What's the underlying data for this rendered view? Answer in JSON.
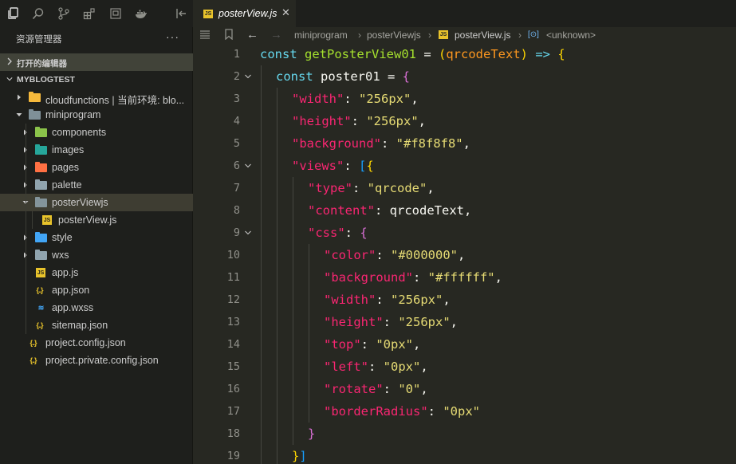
{
  "explorer": {
    "title": "资源管理器",
    "more": "···",
    "open_editors": "打开的编辑器",
    "project": "MYBLOGTEST"
  },
  "tree": [
    {
      "label": "cloudfunctions | 当前环境: blo...",
      "icon": "folder-cloud-icon",
      "color": "#f6b93b",
      "depth": 1,
      "expanded": false
    },
    {
      "label": "miniprogram",
      "icon": "folder-open-icon",
      "color": "#90a4ae",
      "depth": 1,
      "expanded": true
    },
    {
      "label": "components",
      "icon": "folder-components-icon",
      "color": "#8bc34a",
      "depth": 2,
      "expanded": false
    },
    {
      "label": "images",
      "icon": "folder-images-icon",
      "color": "#26a69a",
      "depth": 2,
      "expanded": false
    },
    {
      "label": "pages",
      "icon": "folder-pages-icon",
      "color": "#ff7043",
      "depth": 2,
      "expanded": false
    },
    {
      "label": "palette",
      "icon": "folder-icon",
      "color": "#90a4ae",
      "depth": 2,
      "expanded": false
    },
    {
      "label": "posterViewjs",
      "icon": "folder-open-icon",
      "color": "#90a4ae",
      "depth": 2,
      "expanded": true,
      "selected": true
    },
    {
      "label": "posterView.js",
      "icon": "js-file-icon",
      "color": "#e8c32b",
      "depth": 3
    },
    {
      "label": "style",
      "icon": "folder-style-icon",
      "color": "#42a5f5",
      "depth": 2,
      "expanded": false
    },
    {
      "label": "wxs",
      "icon": "folder-icon",
      "color": "#90a4ae",
      "depth": 2,
      "expanded": false
    },
    {
      "label": "app.js",
      "icon": "js-file-icon",
      "color": "#e8c32b",
      "depth": 2
    },
    {
      "label": "app.json",
      "icon": "json-file-icon",
      "color": "#e8c32b",
      "depth": 2
    },
    {
      "label": "app.wxss",
      "icon": "css-file-icon",
      "color": "#42a5f5",
      "depth": 2
    },
    {
      "label": "sitemap.json",
      "icon": "json-file-icon",
      "color": "#e8c32b",
      "depth": 2
    },
    {
      "label": "project.config.json",
      "icon": "json-file-icon",
      "color": "#e8c32b",
      "depth": 1
    },
    {
      "label": "project.private.config.json",
      "icon": "json-file-icon",
      "color": "#e8c32b",
      "depth": 1
    }
  ],
  "tab": {
    "icon_text": "JS",
    "label": "posterView.js",
    "close": "✕"
  },
  "breadcrumbs": {
    "parts": [
      "miniprogram",
      "posterViewjs",
      "posterView.js",
      "<unknown>"
    ],
    "js_icon": "JS",
    "symbol_icon": "[⊙]"
  },
  "code": {
    "line_numbers": [
      "1",
      "2",
      "3",
      "4",
      "5",
      "6",
      "7",
      "8",
      "9",
      "10",
      "11",
      "12",
      "13",
      "14",
      "15",
      "16",
      "17",
      "18",
      "19"
    ],
    "lines": [
      [
        [
          "kw",
          "const "
        ],
        [
          "fn",
          "getPosterView01"
        ],
        [
          "plain",
          " = "
        ],
        [
          "br1",
          "("
        ],
        [
          "param",
          "qrcodeText"
        ],
        [
          "br1",
          ")"
        ],
        [
          "kw",
          " => "
        ],
        [
          "br1",
          "{"
        ]
      ],
      [
        [
          "kw",
          "const "
        ],
        [
          "plain",
          "poster01 = "
        ],
        [
          "br2",
          "{"
        ]
      ],
      [
        [
          "key",
          "\"width\""
        ],
        [
          "punc",
          ": "
        ],
        [
          "str",
          "\"256px\""
        ],
        [
          "punc",
          ","
        ]
      ],
      [
        [
          "key",
          "\"height\""
        ],
        [
          "punc",
          ": "
        ],
        [
          "str",
          "\"256px\""
        ],
        [
          "punc",
          ","
        ]
      ],
      [
        [
          "key",
          "\"background\""
        ],
        [
          "punc",
          ": "
        ],
        [
          "str",
          "\"#f8f8f8\""
        ],
        [
          "punc",
          ","
        ]
      ],
      [
        [
          "key",
          "\"views\""
        ],
        [
          "punc",
          ": "
        ],
        [
          "br3",
          "["
        ],
        [
          "br1",
          "{"
        ]
      ],
      [
        [
          "key",
          "\"type\""
        ],
        [
          "punc",
          ": "
        ],
        [
          "str",
          "\"qrcode\""
        ],
        [
          "punc",
          ","
        ]
      ],
      [
        [
          "key",
          "\"content\""
        ],
        [
          "punc",
          ": "
        ],
        [
          "plain",
          "qrcodeText"
        ],
        [
          "punc",
          ","
        ]
      ],
      [
        [
          "key",
          "\"css\""
        ],
        [
          "punc",
          ": "
        ],
        [
          "br2",
          "{"
        ]
      ],
      [
        [
          "key",
          "\"color\""
        ],
        [
          "punc",
          ": "
        ],
        [
          "str",
          "\"#000000\""
        ],
        [
          "punc",
          ","
        ]
      ],
      [
        [
          "key",
          "\"background\""
        ],
        [
          "punc",
          ": "
        ],
        [
          "str",
          "\"#ffffff\""
        ],
        [
          "punc",
          ","
        ]
      ],
      [
        [
          "key",
          "\"width\""
        ],
        [
          "punc",
          ": "
        ],
        [
          "str",
          "\"256px\""
        ],
        [
          "punc",
          ","
        ]
      ],
      [
        [
          "key",
          "\"height\""
        ],
        [
          "punc",
          ": "
        ],
        [
          "str",
          "\"256px\""
        ],
        [
          "punc",
          ","
        ]
      ],
      [
        [
          "key",
          "\"top\""
        ],
        [
          "punc",
          ": "
        ],
        [
          "str",
          "\"0px\""
        ],
        [
          "punc",
          ","
        ]
      ],
      [
        [
          "key",
          "\"left\""
        ],
        [
          "punc",
          ": "
        ],
        [
          "str",
          "\"0px\""
        ],
        [
          "punc",
          ","
        ]
      ],
      [
        [
          "key",
          "\"rotate\""
        ],
        [
          "punc",
          ": "
        ],
        [
          "str",
          "\"0\""
        ],
        [
          "punc",
          ","
        ]
      ],
      [
        [
          "key",
          "\"borderRadius\""
        ],
        [
          "punc",
          ": "
        ],
        [
          "str",
          "\"0px\""
        ]
      ],
      [
        [
          "br2",
          "}"
        ]
      ],
      [
        [
          "br1",
          "}"
        ],
        [
          "br3",
          "]"
        ]
      ]
    ],
    "indents": [
      0,
      1,
      2,
      2,
      2,
      2,
      3,
      3,
      3,
      4,
      4,
      4,
      4,
      4,
      4,
      4,
      4,
      3,
      2
    ]
  },
  "colors": {
    "editor_bg": "#272822",
    "sidebar_bg": "#1e1f1c",
    "selection": "#3e3d32"
  }
}
